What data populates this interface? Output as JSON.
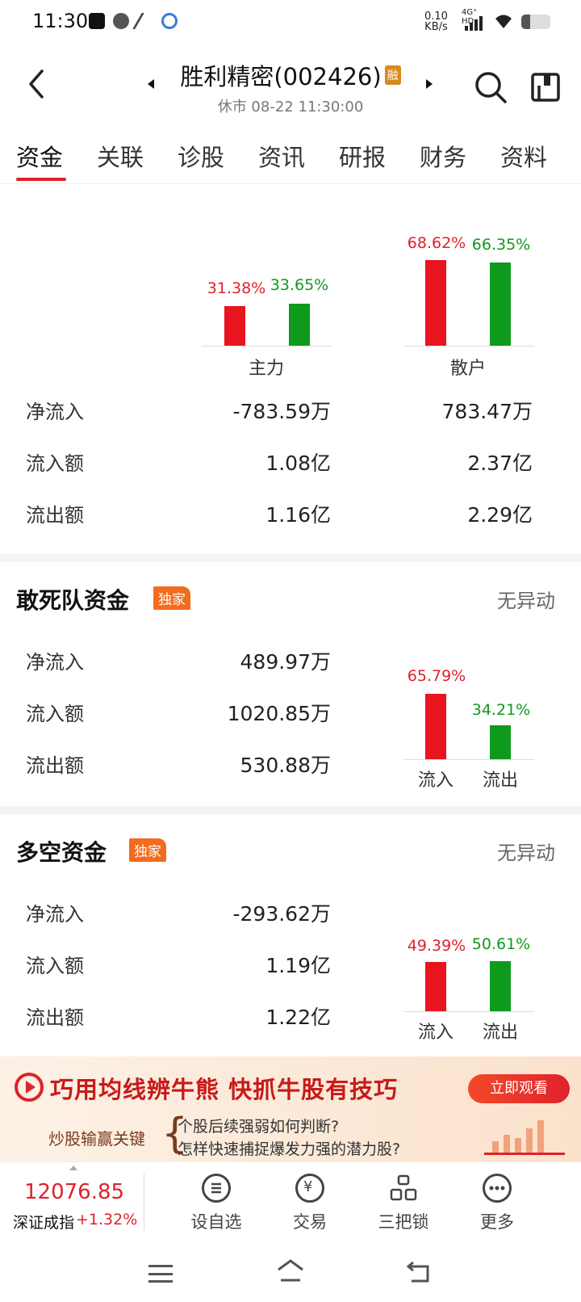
{
  "status_bar": {
    "time": "11:30",
    "net_speed_value": "0.10",
    "net_speed_unit": "KB/s",
    "network": "4G⁺ HD"
  },
  "header": {
    "title": "胜利精密(002426)",
    "margin_badge": "融",
    "subtitle": "休市 08-22 11:30:00"
  },
  "tabs": [
    "资金",
    "关联",
    "诊股",
    "资讯",
    "研报",
    "财务",
    "资料"
  ],
  "main_fund": {
    "groups": [
      {
        "name": "主力",
        "inflow_pct": "31.38%",
        "outflow_pct": "33.65%",
        "inflow_value": 31.38,
        "outflow_value": 33.65
      },
      {
        "name": "散户",
        "inflow_pct": "68.62%",
        "outflow_pct": "66.35%",
        "inflow_value": 68.62,
        "outflow_value": 66.35
      }
    ],
    "rows": [
      {
        "label": "净流入",
        "main": "-783.59万",
        "retail": "783.47万"
      },
      {
        "label": "流入额",
        "main": "1.08亿",
        "retail": "2.37亿"
      },
      {
        "label": "流出额",
        "main": "1.16亿",
        "retail": "2.29亿"
      }
    ]
  },
  "daredevil_fund": {
    "title": "敢死队资金",
    "badge": "独家",
    "status": "无异动",
    "rows": [
      {
        "label": "净流入",
        "value": "489.97万"
      },
      {
        "label": "流入额",
        "value": "1020.85万"
      },
      {
        "label": "流出额",
        "value": "530.88万"
      }
    ],
    "chart": {
      "inflow_label": "流入",
      "outflow_label": "流出",
      "inflow_pct": "65.79%",
      "outflow_pct": "34.21%",
      "inflow_value": 65.79,
      "outflow_value": 34.21
    }
  },
  "longshort_fund": {
    "title": "多空资金",
    "badge": "独家",
    "status": "无异动",
    "rows": [
      {
        "label": "净流入",
        "value": "-293.62万"
      },
      {
        "label": "流入额",
        "value": "1.19亿"
      },
      {
        "label": "流出额",
        "value": "1.22亿"
      }
    ],
    "chart": {
      "inflow_label": "流入",
      "outflow_label": "流出",
      "inflow_pct": "49.39%",
      "outflow_pct": "50.61%",
      "inflow_value": 49.39,
      "outflow_value": 50.61
    }
  },
  "banner": {
    "title": "巧用均线辨牛熊  快抓牛股有技巧",
    "button": "立即观看",
    "key": "炒股输赢关键",
    "q1": "个股后续强弱如何判断?",
    "q2": "怎样快速捕捉爆发力强的潜力股?"
  },
  "bottom_bar": {
    "index_value": "12076.85",
    "index_name": "深证成指",
    "index_change": "+1.32%",
    "nav": [
      {
        "label": "设自选",
        "icon": "list-icon"
      },
      {
        "label": "交易",
        "icon": "yuan-icon"
      },
      {
        "label": "三把锁",
        "icon": "lock-icon"
      },
      {
        "label": "更多",
        "icon": "more-icon"
      }
    ]
  },
  "colors": {
    "up": "#e0212b",
    "down": "#0f9a1e",
    "badge": "#f36b1c"
  }
}
